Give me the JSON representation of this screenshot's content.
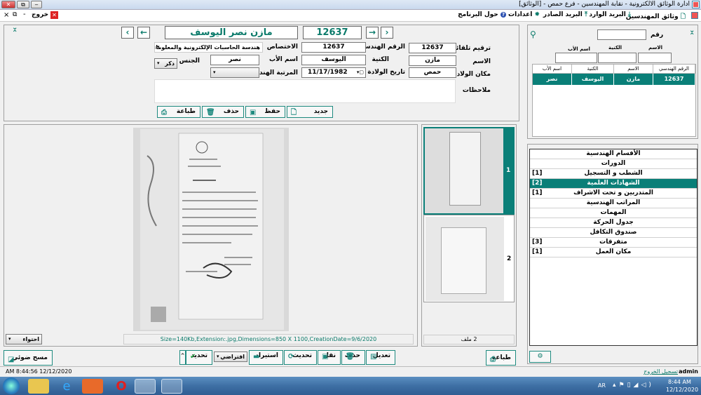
{
  "window": {
    "title": "ادارة الوثائق الالكترونية - نقابة المهندسين - فرع حمص - [الوثائق]"
  },
  "menu": {
    "items": [
      {
        "label": "وثائق المهندسين",
        "icon": "document-icon"
      },
      {
        "label": "البريد الوارد",
        "icon": "download-icon"
      },
      {
        "label": "البريد الصادر",
        "icon": "upload-icon"
      },
      {
        "label": "اعدادات",
        "icon": "gear-icon"
      },
      {
        "label": "حول البرنامج",
        "icon": "help-icon"
      }
    ],
    "exit_label": "خروج"
  },
  "nav": {
    "record_number": "12637",
    "record_name": "مازن نصر اليوسف"
  },
  "form": {
    "auto_number": {
      "label": "ترقيم تلقائي",
      "value": "12637"
    },
    "eng_number": {
      "label": "الرقم الهندسي",
      "value": "12637"
    },
    "specialty": {
      "label": "الاختصاص",
      "value": "هندسة الحاسبات الإلكترونية والمعلوماتية"
    },
    "first_name": {
      "label": "الاسم",
      "value": "مازن"
    },
    "last_name": {
      "label": "الكنية",
      "value": "اليوسف"
    },
    "father_name": {
      "label": "اسم الأب",
      "value": "نصر"
    },
    "gender": {
      "label": "الجنس",
      "value": "ذكر"
    },
    "birth_place": {
      "label": "مكان الولادة",
      "value": "حمص"
    },
    "birth_date": {
      "label": "تاريخ الولادة",
      "value": "11/17/1982"
    },
    "eng_rank": {
      "label": "المرتبة الهندسية",
      "value": ""
    },
    "notes": {
      "label": "ملاحظات",
      "value": ""
    },
    "buttons": {
      "new": "جديد",
      "save": "حفظ",
      "delete": "حذف",
      "print": "طباعة"
    }
  },
  "search": {
    "number_label": "رقم",
    "number_value": "",
    "first_label": "الاسم",
    "last_label": "الكنية",
    "father_label": "اسم الأب",
    "columns": [
      "الرقم الهندسي",
      "الاسم",
      "الكنية",
      "اسم الأب"
    ],
    "rows": [
      [
        "12637",
        "مازن",
        "اليوسف",
        "نصر"
      ]
    ]
  },
  "categories": [
    {
      "label": "الأقسام الهندسية",
      "count": ""
    },
    {
      "label": "الدورات",
      "count": ""
    },
    {
      "label": "الشطب و التسجيل",
      "count": "[1]"
    },
    {
      "label": "الشهادات العلمية",
      "count": "[2]",
      "active": true
    },
    {
      "label": "المتدربين و تحت الاشراف",
      "count": "[1]"
    },
    {
      "label": "المراتب الهندسية",
      "count": ""
    },
    {
      "label": "المهمات",
      "count": ""
    },
    {
      "label": "جدول الحركة",
      "count": ""
    },
    {
      "label": "صندوق التكافل",
      "count": ""
    },
    {
      "label": "متفرقات",
      "count": "[3]"
    },
    {
      "label": "مكان العمل",
      "count": "[1]"
    }
  ],
  "viewer": {
    "fit_mode": "احتواء",
    "file_info": "Size=140Kb,Extension:.jpg,Dimensions=850 X 1100,CreationDate=9/6/2020",
    "thumbnails": [
      "1",
      "2"
    ],
    "file_count": "2 ملف"
  },
  "toolbar": {
    "scan": "مسح ضوئي",
    "print": "طباعة",
    "edit": "تعديل",
    "delete": "حذف",
    "move": "نقل",
    "refresh": "تحديث",
    "import": "استيراد",
    "profile": "افتراضي",
    "select": "تحديد"
  },
  "status": {
    "datetime": "AM 8:44:56 12/12/2020",
    "user": "admin",
    "logout": "تسجيل الخروج"
  },
  "taskbar": {
    "lang": "AR",
    "time": "8:44 AM",
    "date": "12/12/2020"
  },
  "colors": {
    "accent": "#0a7f78",
    "selected_row": "#0a7f78"
  }
}
